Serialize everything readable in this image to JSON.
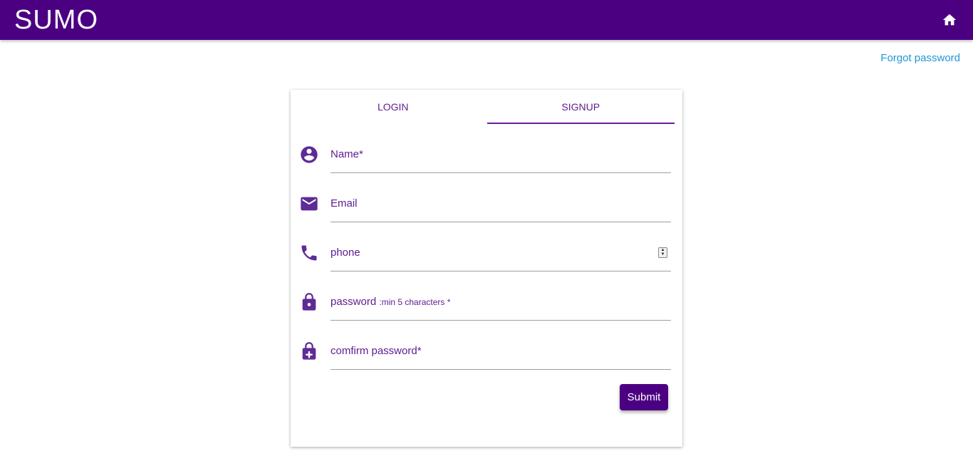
{
  "app": {
    "title": "SUMO",
    "home_icon": "home-icon"
  },
  "links": {
    "forgot_password": "Forgot password"
  },
  "tabs": [
    {
      "label": "LOGIN",
      "active": false
    },
    {
      "label": "SIGNUP",
      "active": true
    }
  ],
  "form": {
    "fields": [
      {
        "icon": "account-circle-icon",
        "label": "Name*",
        "value": ""
      },
      {
        "icon": "mail-icon",
        "label": "Email",
        "value": ""
      },
      {
        "icon": "phone-icon",
        "label": "phone",
        "value": ""
      },
      {
        "icon": "lock-icon",
        "label": "password",
        "hint": ":min 5 characters *",
        "value": ""
      },
      {
        "icon": "lock-plus-icon",
        "label": "comfirm password*",
        "value": ""
      }
    ],
    "submit_label": "Submit"
  },
  "colors": {
    "primary": "#4b0082",
    "accent_text": "#5e1c8f",
    "link": "#2196d3",
    "divider": "#9e9e9e"
  }
}
